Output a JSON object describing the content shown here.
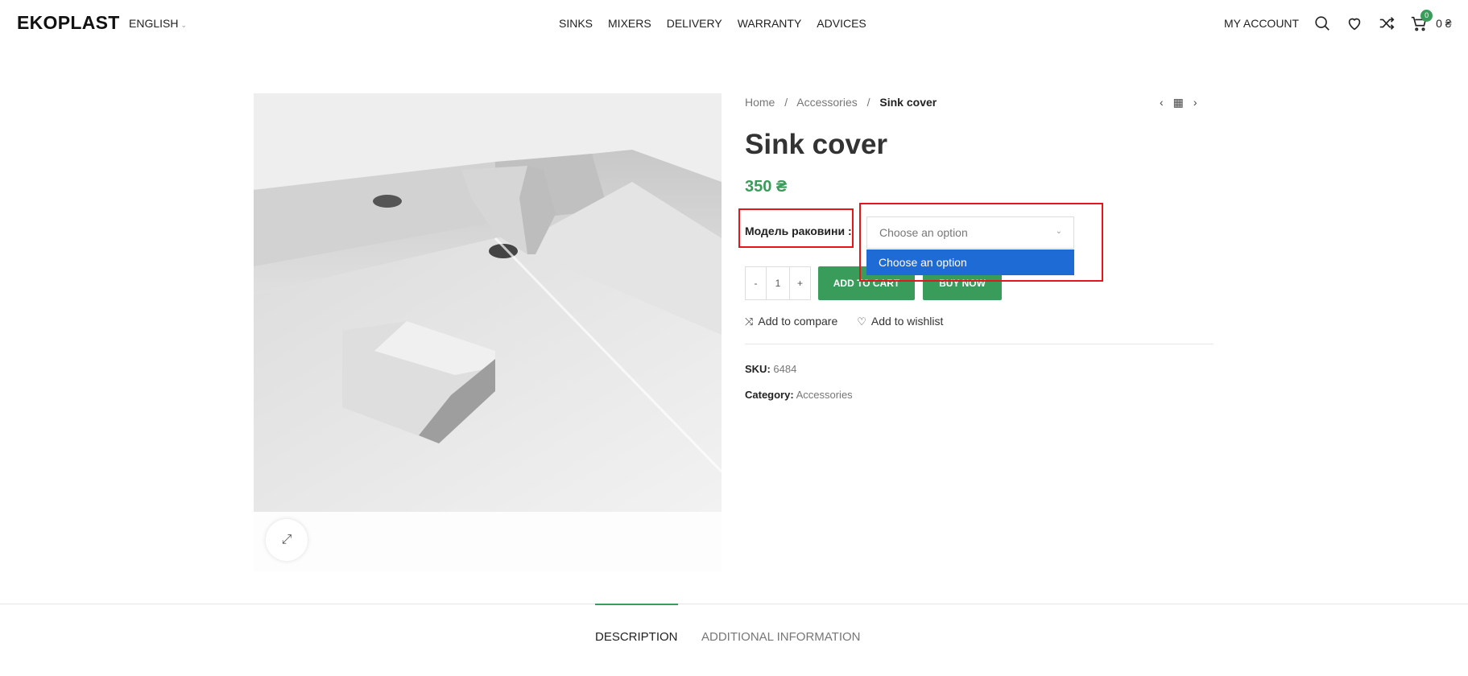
{
  "header": {
    "logo": "EKOPLAST",
    "language": "ENGLISH",
    "nav": [
      "SINKS",
      "MIXERS",
      "DELIVERY",
      "WARRANTY",
      "ADVICES"
    ],
    "my_account": "MY ACCOUNT",
    "cart_count": "0",
    "cart_total": "0 ₴",
    "icons": [
      "search-icon",
      "heart-icon",
      "compare-icon",
      "cart-icon"
    ]
  },
  "breadcrumb": {
    "home": "Home",
    "sep": "/",
    "category": "Accessories",
    "current": "Sink cover"
  },
  "product": {
    "title": "Sink cover",
    "price": "350 ₴",
    "attribute_label": "Модель раковини :",
    "select_placeholder": "Choose an option",
    "dropdown_option": "Choose an option",
    "qty_minus": "-",
    "qty_value": "1",
    "qty_plus": "+",
    "add_to_cart": "ADD TO CART",
    "buy_now": "BUY NOW",
    "add_to_compare": "Add to compare",
    "add_to_wishlist": "Add to wishlist",
    "sku_label": "SKU:",
    "sku_value": "6484",
    "category_label": "Category:",
    "category_value": "Accessories"
  },
  "tabs": {
    "description": "DESCRIPTION",
    "additional": "ADDITIONAL INFORMATION"
  },
  "colors": {
    "accent_green": "#3a9c5a",
    "highlight_red": "#e3161c",
    "dropdown_blue": "#1e6bd6"
  }
}
